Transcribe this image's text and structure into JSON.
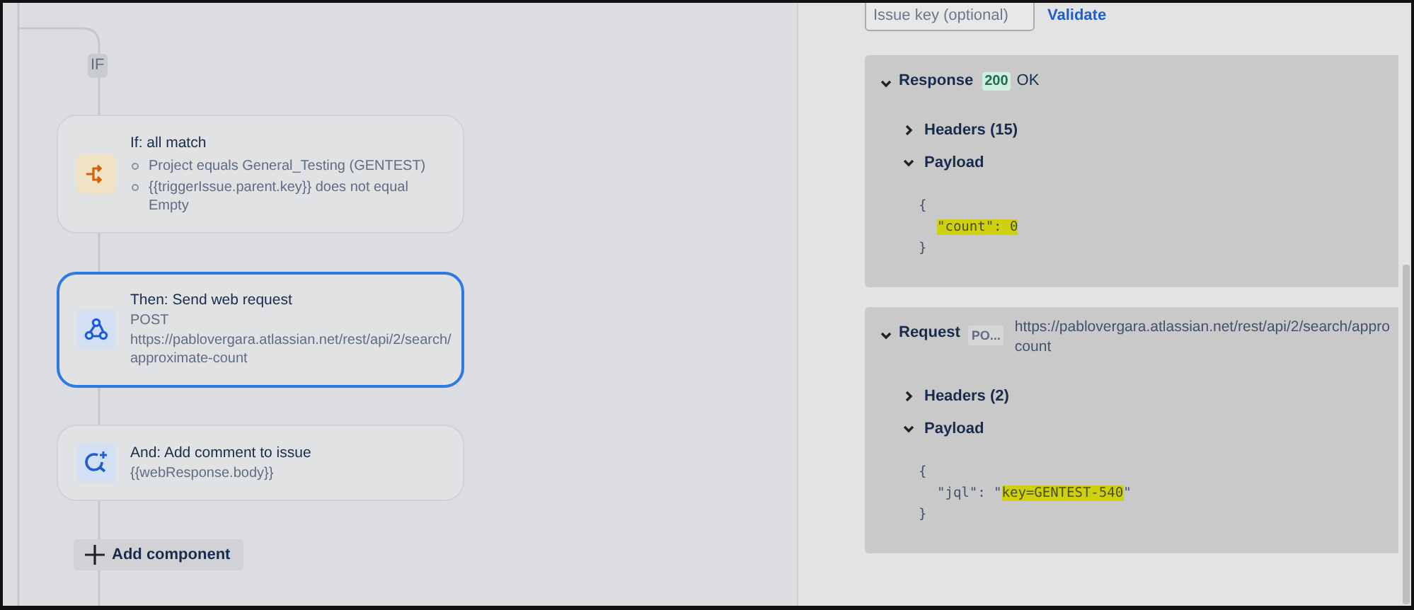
{
  "flow": {
    "branch_label": "IF",
    "components": [
      {
        "kind": "condition",
        "title": "If: all match",
        "selected": false,
        "conditions": [
          "Project equals General_Testing (GENTEST)",
          "{{triggerIssue.parent.key}} does not equal Empty"
        ]
      },
      {
        "kind": "webhook",
        "title": "Then: Send web request",
        "selected": true,
        "lines": [
          "POST",
          "https://pablovergara.atlassian.net/rest/api/2/search/approximate-count"
        ]
      },
      {
        "kind": "comment",
        "title": "And: Add comment to issue",
        "selected": false,
        "lines": [
          "{{webResponse.body}}"
        ]
      }
    ],
    "add_button": "Add component"
  },
  "validator": {
    "issue_key": {
      "placeholder": "Issue key (optional)"
    },
    "validate_link": "Validate"
  },
  "response": {
    "label": "Response",
    "expanded": true,
    "status_code": "200",
    "status_text": "OK",
    "sections": [
      {
        "label": "Headers (15)",
        "expanded": false
      },
      {
        "label": "Payload",
        "expanded": true,
        "code": [
          {
            "indented": false,
            "segments": [
              {
                "text": "{",
                "highlighted": false
              }
            ]
          },
          {
            "indented": true,
            "segments": [
              {
                "text": "\"count\": 0",
                "highlighted": true
              }
            ]
          },
          {
            "indented": false,
            "segments": [
              {
                "text": "}",
                "highlighted": false
              }
            ]
          }
        ]
      }
    ]
  },
  "request": {
    "label": "Request",
    "expanded": true,
    "method": "PO...",
    "url_lines": [
      "https://pablovergara.atlassian.net/rest/api/2/search/appro",
      "count"
    ],
    "sections": [
      {
        "label": "Headers (2)",
        "expanded": false
      },
      {
        "label": "Payload",
        "expanded": true,
        "code": [
          {
            "indented": false,
            "segments": [
              {
                "text": "{",
                "highlighted": false
              }
            ]
          },
          {
            "indented": true,
            "segments": [
              {
                "text": "\"jql\": \"",
                "highlighted": false
              },
              {
                "text": "key=GENTEST-540",
                "highlighted": true
              },
              {
                "text": "\"",
                "highlighted": false
              }
            ]
          },
          {
            "indented": false,
            "segments": [
              {
                "text": "}",
                "highlighted": false
              }
            ]
          }
        ]
      }
    ]
  }
}
